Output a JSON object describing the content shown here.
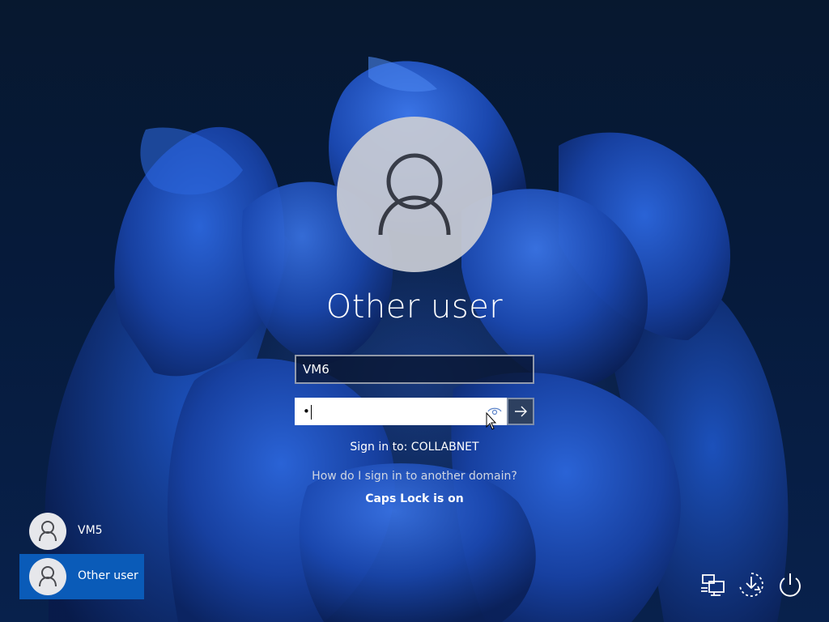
{
  "lock_screen": {
    "selected_user_name": "Other user",
    "username_value": "VM6",
    "password_value": "•",
    "sign_in_domain_text": "Sign in to: COLLABNET",
    "other_domain_link": "How do I sign in to another domain?",
    "caps_lock_warning": "Caps Lock is on"
  },
  "user_list": [
    {
      "name": "VM5",
      "selected": false
    },
    {
      "name": "Other user",
      "selected": true
    }
  ],
  "system_icons": [
    "network-icon",
    "accessibility-icon",
    "power-icon"
  ],
  "colors": {
    "selected_user_bg": "#0a5bb8",
    "background": "#06162e",
    "submit_button_bg": "#2d4060"
  }
}
